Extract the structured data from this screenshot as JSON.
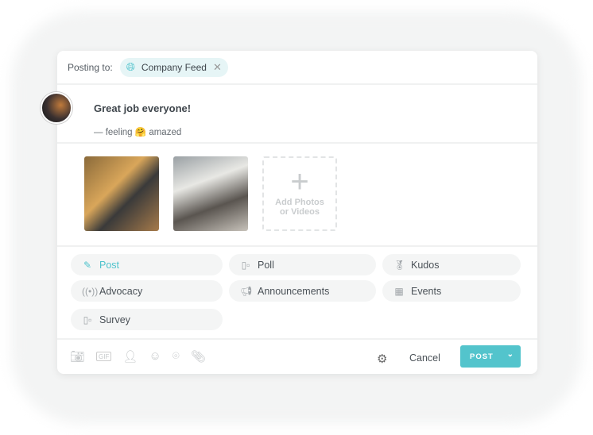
{
  "header": {
    "posting_to_label": "Posting to:",
    "audience": "Company Feed",
    "audience_icon": "globe-icon"
  },
  "composer": {
    "message": "Great job everyone!",
    "feeling_prefix": "— feeling",
    "feeling_emoji": "🤗",
    "feeling": "amazed"
  },
  "media": {
    "add_label_1": "Add Photos",
    "add_label_2": "or Videos"
  },
  "post_types": [
    {
      "label": "Post",
      "icon": "pencil-icon",
      "active": true
    },
    {
      "label": "Poll",
      "icon": "bar-chart-icon"
    },
    {
      "label": "Kudos",
      "icon": "award-icon"
    },
    {
      "label": "Advocacy",
      "icon": "broadcast-icon"
    },
    {
      "label": "Announcements",
      "icon": "megaphone-icon"
    },
    {
      "label": "Events",
      "icon": "calendar-icon"
    },
    {
      "label": "Survey",
      "icon": "bar-chart-icon"
    }
  ],
  "footer": {
    "cancel": "Cancel",
    "post": "POST",
    "gif": "GIF"
  },
  "colors": {
    "accent": "#53c4cc"
  }
}
